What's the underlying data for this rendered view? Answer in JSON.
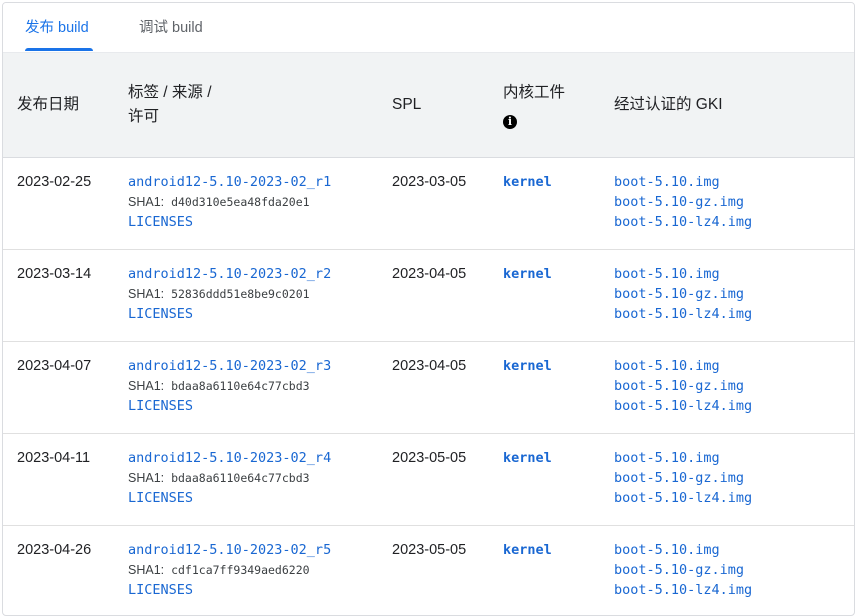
{
  "tabs": [
    {
      "label": "发布 build",
      "active": true
    },
    {
      "label": "调试 build",
      "active": false
    }
  ],
  "colors": {
    "accent": "#1a73e8",
    "link": "#1967d2",
    "header_bg": "#f1f3f4"
  },
  "headers": {
    "date": "发布日期",
    "tag_line1": "标签 / 来源 /",
    "tag_line2": "许可",
    "spl": "SPL",
    "kernel": "内核工件",
    "kernel_info_icon": "info-icon",
    "gki": "经过认证的 GKI"
  },
  "rows": [
    {
      "date": "2023-02-25",
      "tag": "android12-5.10-2023-02_r1",
      "sha_label": "SHA1:",
      "sha": "d40d310e5ea48fda20e1",
      "licenses": "LICENSES",
      "spl": "2023-03-05",
      "kernel": "kernel",
      "gki": [
        "boot-5.10.img",
        "boot-5.10-gz.img",
        "boot-5.10-lz4.img"
      ]
    },
    {
      "date": "2023-03-14",
      "tag": "android12-5.10-2023-02_r2",
      "sha_label": "SHA1:",
      "sha": "52836ddd51e8be9c0201",
      "licenses": "LICENSES",
      "spl": "2023-04-05",
      "kernel": "kernel",
      "gki": [
        "boot-5.10.img",
        "boot-5.10-gz.img",
        "boot-5.10-lz4.img"
      ]
    },
    {
      "date": "2023-04-07",
      "tag": "android12-5.10-2023-02_r3",
      "sha_label": "SHA1:",
      "sha": "bdaa8a6110e64c77cbd3",
      "licenses": "LICENSES",
      "spl": "2023-04-05",
      "kernel": "kernel",
      "gki": [
        "boot-5.10.img",
        "boot-5.10-gz.img",
        "boot-5.10-lz4.img"
      ]
    },
    {
      "date": "2023-04-11",
      "tag": "android12-5.10-2023-02_r4",
      "sha_label": "SHA1:",
      "sha": "bdaa8a6110e64c77cbd3",
      "licenses": "LICENSES",
      "spl": "2023-05-05",
      "kernel": "kernel",
      "gki": [
        "boot-5.10.img",
        "boot-5.10-gz.img",
        "boot-5.10-lz4.img"
      ]
    },
    {
      "date": "2023-04-26",
      "tag": "android12-5.10-2023-02_r5",
      "sha_label": "SHA1:",
      "sha": "cdf1ca7ff9349aed6220",
      "licenses": "LICENSES",
      "spl": "2023-05-05",
      "kernel": "kernel",
      "gki": [
        "boot-5.10.img",
        "boot-5.10-gz.img",
        "boot-5.10-lz4.img"
      ]
    }
  ]
}
